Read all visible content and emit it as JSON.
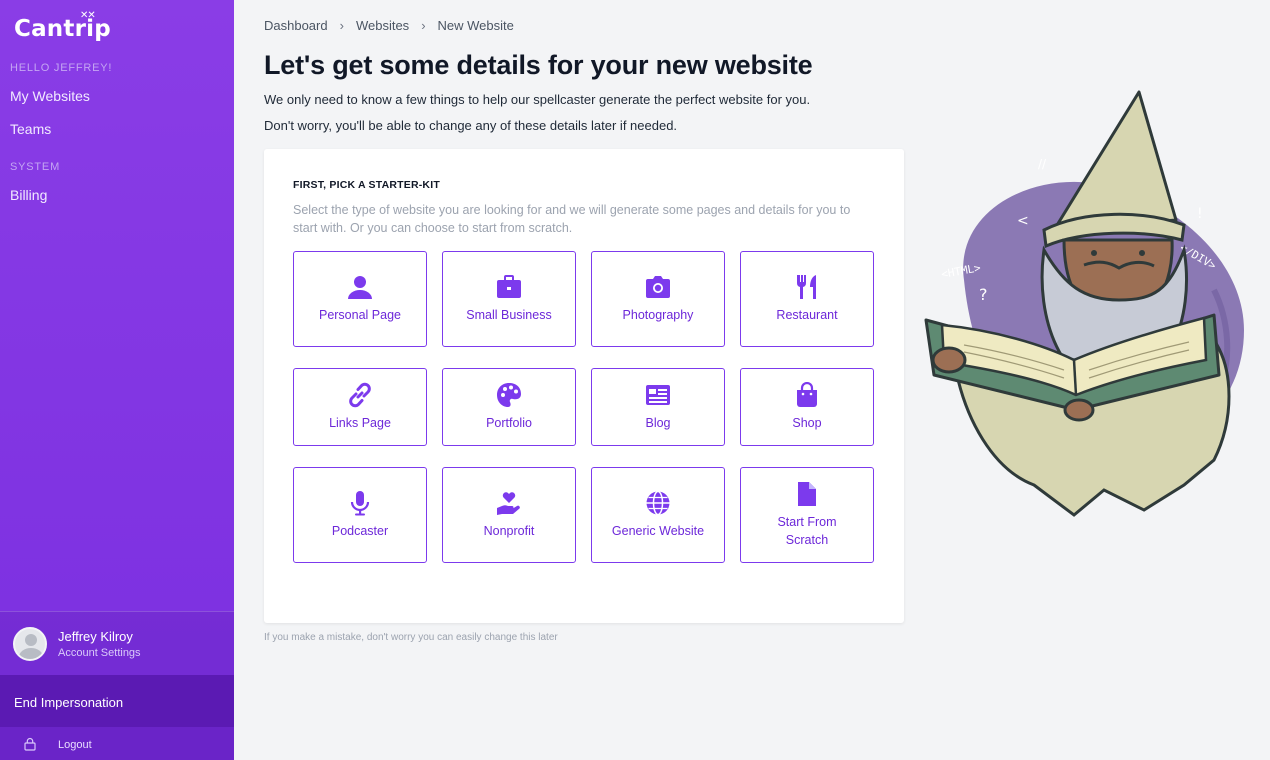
{
  "app": {
    "name": "Cantrip"
  },
  "sidebar": {
    "greeting": "HELLO JEFFREY!",
    "items": [
      {
        "label": "My Websites"
      },
      {
        "label": "Teams"
      }
    ],
    "system_heading": "SYSTEM",
    "system_items": [
      {
        "label": "Billing"
      }
    ],
    "user": {
      "name": "Jeffrey Kilroy",
      "settings_label": "Account Settings"
    },
    "end_impersonation_label": "End Impersonation",
    "logout_label": "Logout"
  },
  "breadcrumb": [
    "Dashboard",
    "Websites",
    "New Website"
  ],
  "page": {
    "title": "Let's get some details for your new website",
    "subtitle_1": "We only need to know a few things to help our spellcaster generate the perfect website for you.",
    "subtitle_2": "Don't worry, you'll be able to change any of these details later if needed."
  },
  "starter_kit": {
    "heading": "FIRST, PICK A STARTER-KIT",
    "description": "Select the type of website you are looking for and we will generate some pages and details for you to start with. Or you can choose to start from scratch.",
    "options": [
      {
        "label": "Personal Page",
        "icon": "user-icon"
      },
      {
        "label": "Small Business",
        "icon": "briefcase-icon"
      },
      {
        "label": "Photography",
        "icon": "camera-icon"
      },
      {
        "label": "Restaurant",
        "icon": "utensils-icon"
      },
      {
        "label": "Links Page",
        "icon": "link-icon"
      },
      {
        "label": "Portfolio",
        "icon": "palette-icon"
      },
      {
        "label": "Blog",
        "icon": "newspaper-icon"
      },
      {
        "label": "Shop",
        "icon": "shopping-bag-icon"
      },
      {
        "label": "Podcaster",
        "icon": "microphone-icon"
      },
      {
        "label": "Nonprofit",
        "icon": "hand-heart-icon"
      },
      {
        "label": "Generic Website",
        "icon": "globe-icon"
      },
      {
        "label": "Start From Scratch",
        "icon": "file-icon"
      }
    ]
  },
  "footnote": "If you make a mistake, don't worry you can easily change this later",
  "illustration": {
    "icon": "wizard-reading-book-illustration",
    "doodles": [
      "<HTML>",
      "</DIV>"
    ]
  },
  "colors": {
    "sidebar": "#7b2fe0",
    "accent": "#7c3aed",
    "background": "#f3f4f6"
  }
}
